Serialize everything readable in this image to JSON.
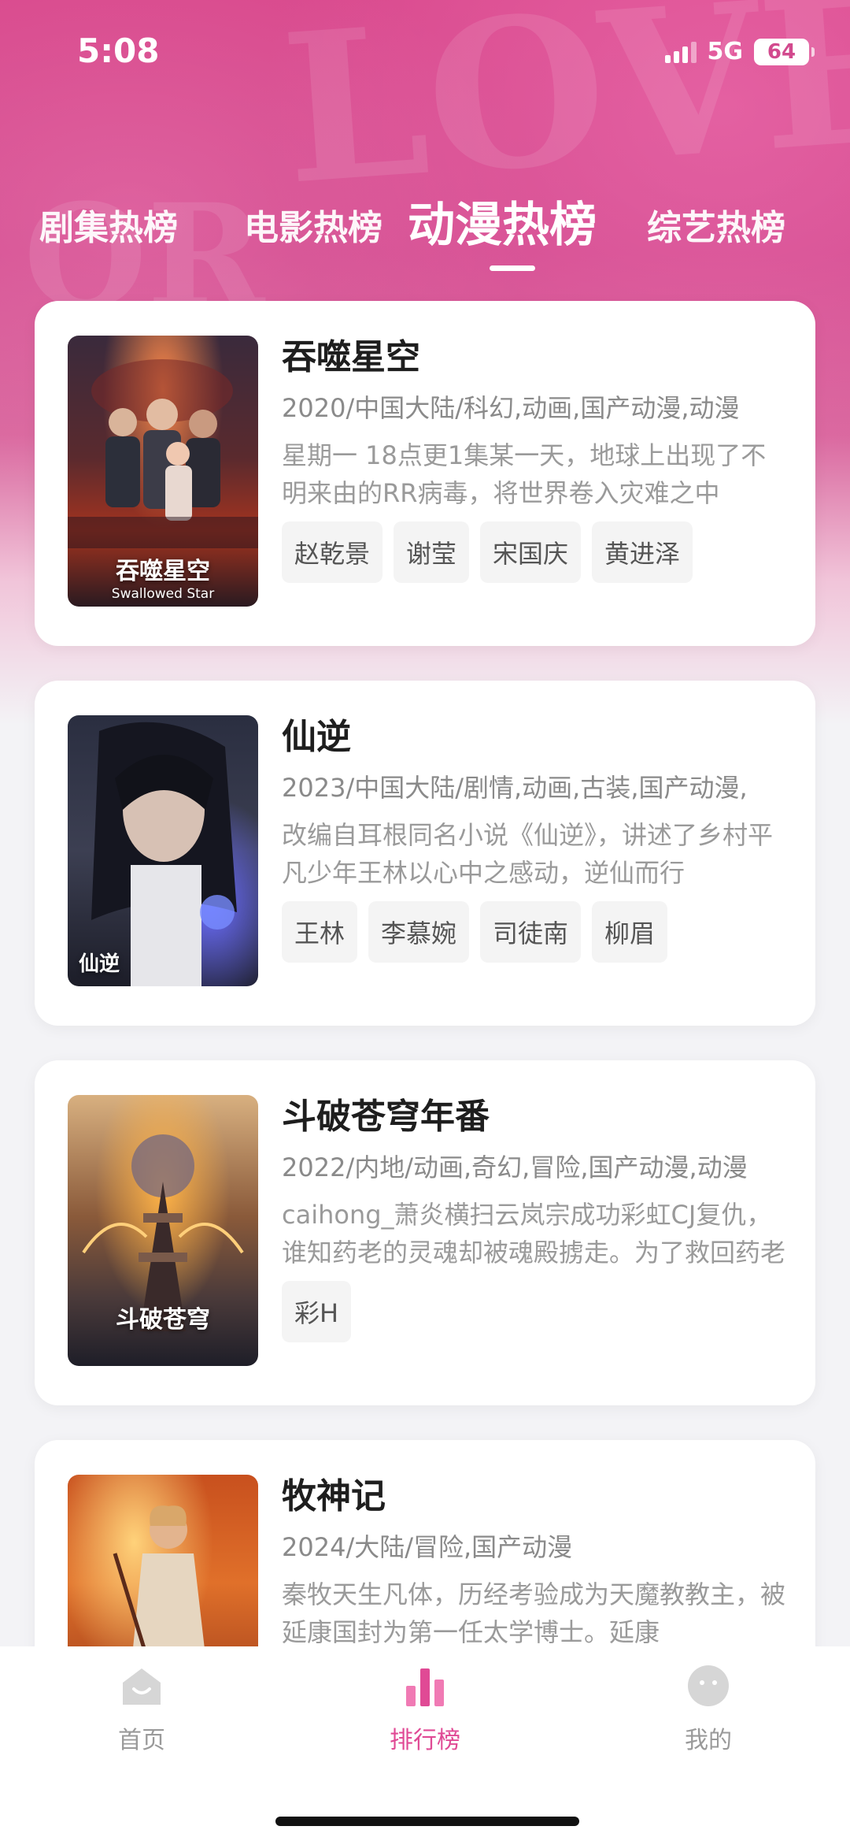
{
  "status_bar": {
    "time": "5:08",
    "network": "5G",
    "battery": "64"
  },
  "tabs": [
    {
      "label": "剧集热榜",
      "active": false
    },
    {
      "label": "电影热榜",
      "active": false
    },
    {
      "label": "动漫热榜",
      "active": true
    },
    {
      "label": "综艺热榜",
      "active": false
    }
  ],
  "cards": [
    {
      "title": "吞噬星空",
      "meta": "2020/中国大陆/科幻,动画,国产动漫,动漫",
      "desc": "星期一 18点更1集某一天，地球上出现了不明来由的RR病毒，将世界卷入灾难之中",
      "tags": [
        "赵乾景",
        "谢莹",
        "宋国庆",
        "黄进泽"
      ],
      "poster": {
        "title": "吞噬星空",
        "subtitle": "Swallowed Star"
      }
    },
    {
      "title": "仙逆",
      "meta": "2023/中国大陆/剧情,动画,古装,国产动漫,",
      "desc": "改编自耳根同名小说《仙逆》，讲述了乡村平凡少年王林以心中之感动，逆仙而行",
      "tags": [
        "王林",
        "李慕婉",
        "司徒南",
        "柳眉"
      ],
      "poster": {
        "title": "仙逆",
        "subtitle": ""
      }
    },
    {
      "title": "斗破苍穹年番",
      "meta": "2022/内地/动画,奇幻,冒险,国产动漫,动漫",
      "desc": "caihong_萧炎横扫云岚宗成功彩虹CJ复仇，谁知药老的灵魂却被魂殿掳走。为了救回药老",
      "tags": [
        "彩H"
      ],
      "poster": {
        "title": "斗破苍穹",
        "subtitle": ""
      }
    },
    {
      "title": "牧神记",
      "meta": "2024/大陆/冒险,国产动漫",
      "desc": "秦牧天生凡体，历经考验成为天魔教教主，被延康国封为第一任太学博士。延康",
      "tags": [],
      "poster": {
        "title": "",
        "subtitle": ""
      }
    }
  ],
  "bottom_nav": [
    {
      "label": "首页",
      "icon": "home-icon",
      "active": false
    },
    {
      "label": "排行榜",
      "icon": "ranking-icon",
      "active": true
    },
    {
      "label": "我的",
      "icon": "profile-icon",
      "active": false
    }
  ],
  "colors": {
    "accent": "#e04a95",
    "header": "#d24a8e"
  }
}
